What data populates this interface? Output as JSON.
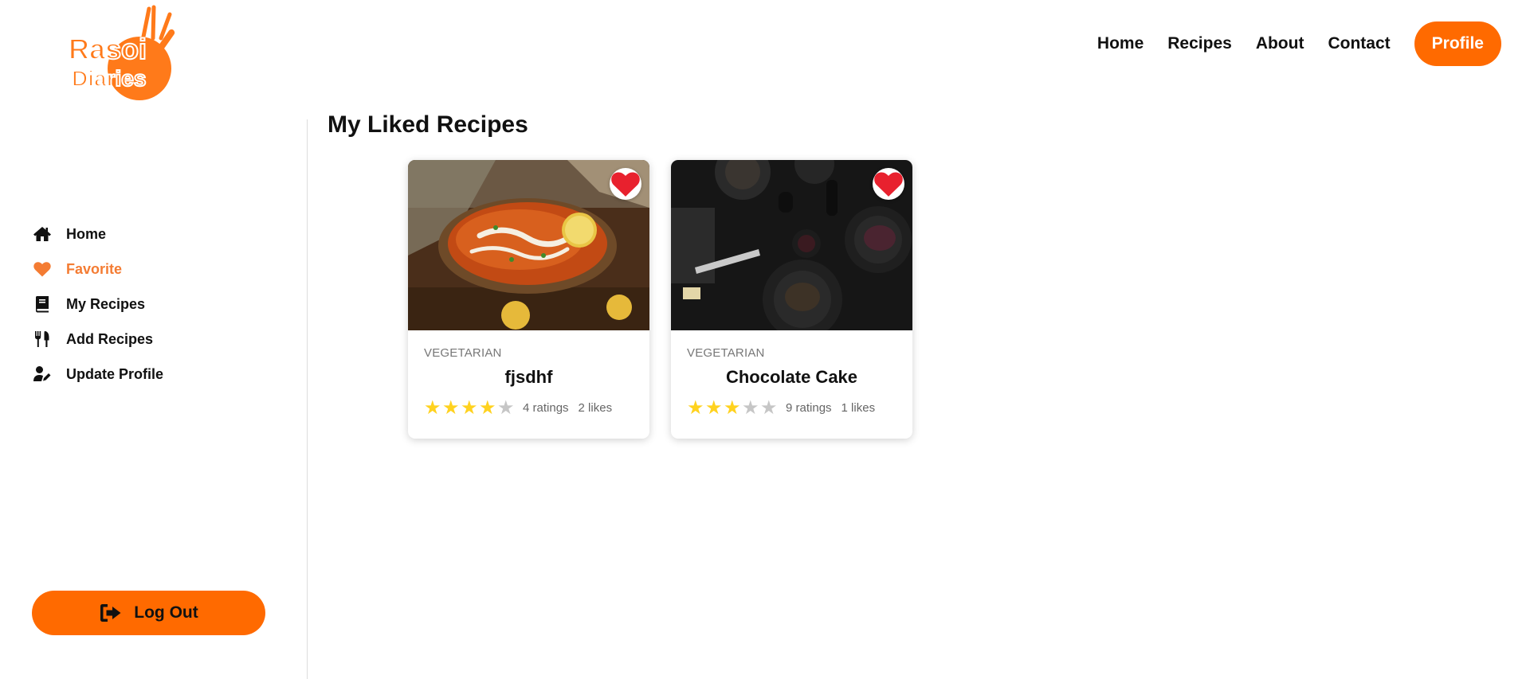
{
  "brand": {
    "logo_line1": "Rasoi",
    "logo_line2": "Diaries",
    "accent": "#ff6a00"
  },
  "topnav": {
    "links": [
      "Home",
      "Recipes",
      "About",
      "Contact"
    ],
    "profile_label": "Profile"
  },
  "sidebar": {
    "items": [
      {
        "label": "Home",
        "icon": "home-icon",
        "active": false
      },
      {
        "label": "Favorite",
        "icon": "heart-icon",
        "active": true
      },
      {
        "label": "My Recipes",
        "icon": "book-icon",
        "active": false
      },
      {
        "label": "Add Recipes",
        "icon": "utensils-icon",
        "active": false
      },
      {
        "label": "Update Profile",
        "icon": "user-edit-icon",
        "active": false
      }
    ],
    "logout_label": "Log Out"
  },
  "main": {
    "title": "My Liked Recipes",
    "cards": [
      {
        "category": "VEGETARIAN",
        "title": "fjsdhf",
        "rating": 4,
        "ratings_text": "4 ratings",
        "likes_text": "2 likes",
        "liked": true
      },
      {
        "category": "VEGETARIAN",
        "title": "Chocolate Cake",
        "rating": 3,
        "ratings_text": "9 ratings",
        "likes_text": "1 likes",
        "liked": true
      }
    ]
  }
}
